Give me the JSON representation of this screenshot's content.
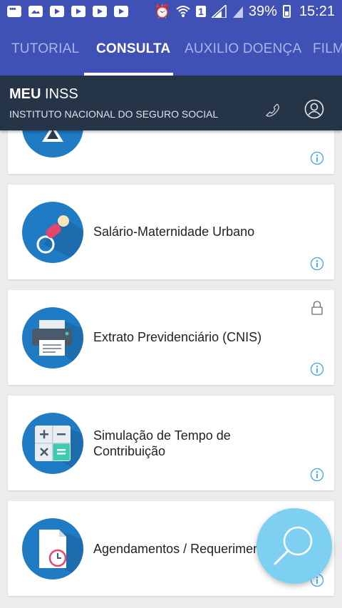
{
  "status_bar": {
    "signal_sim": "1",
    "battery_percent": "39%",
    "time": "15:21"
  },
  "tabs": [
    {
      "label": "TUTORIAL",
      "active": false
    },
    {
      "label": "CONSULTA",
      "active": true
    },
    {
      "label": "AUXILIO DOENÇA",
      "active": false
    },
    {
      "label": "FILM",
      "active": false
    }
  ],
  "header": {
    "title_bold": "MEU",
    "title_rest": " INSS",
    "subtitle": "INSTITUTO NACIONAL DO SEGURO SOCIAL",
    "icons": [
      "phone-icon",
      "user-icon"
    ]
  },
  "cards": [
    {
      "label": "",
      "icon": "scale-icon",
      "locked": false
    },
    {
      "label": "Salário-Maternidade Urbano",
      "icon": "pacifier-icon",
      "locked": false
    },
    {
      "label": "Extrato Previdenciário (CNIS)",
      "icon": "printer-icon",
      "locked": true
    },
    {
      "label_line1": "Simulação de Tempo de",
      "label_line2": "Contribuição",
      "icon": "calculator-icon",
      "locked": false
    },
    {
      "label": "Agendamentos / Requerimentos",
      "icon": "document-clock-icon",
      "locked": false
    }
  ],
  "fab": {
    "icon": "search-icon"
  },
  "colors": {
    "primary": "#3f51b5",
    "header": "#253446",
    "icon_circle": "#1f7bc3",
    "fab": "#7dd0f2",
    "info": "#3ea8df"
  }
}
